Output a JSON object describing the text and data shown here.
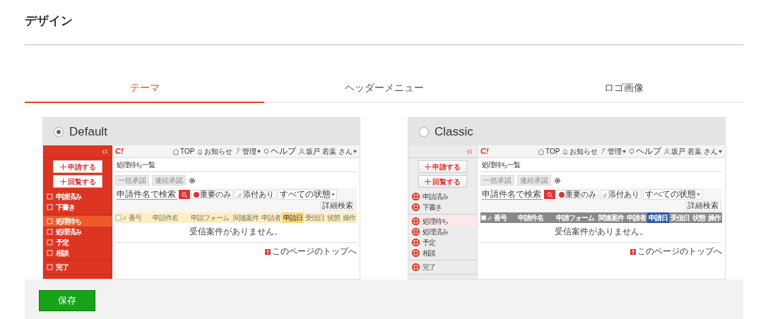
{
  "page_title": "デザイン",
  "tabs": [
    {
      "label": "テーマ",
      "selected": true
    },
    {
      "label": "ヘッダーメニュー",
      "selected": false
    },
    {
      "label": "ロゴ画像",
      "selected": false
    }
  ],
  "themes": [
    {
      "name": "Default",
      "kind": "default",
      "selected": true,
      "preview": {
        "sidebar_buttons": [
          "申請する",
          "回覧する"
        ],
        "sidebar_groups": [
          [
            {
              "label": "申請済み",
              "selected": false
            },
            {
              "label": "下書き",
              "selected": false
            }
          ],
          [
            {
              "label": "処理待ち",
              "selected": true
            },
            {
              "label": "処理済み",
              "selected": false
            },
            {
              "label": "予定",
              "selected": false
            },
            {
              "label": "相談",
              "selected": false
            }
          ],
          [
            {
              "label": "完了",
              "selected": false
            }
          ]
        ],
        "logo": "C!",
        "nav": [
          {
            "label": "TOP",
            "caret": false
          },
          {
            "label": "お知らせ",
            "caret": false
          },
          {
            "label": "管理",
            "caret": true
          },
          {
            "label": "ヘルプ",
            "caret": false
          },
          {
            "label": "坂戸 若葉 さん",
            "caret": true
          }
        ],
        "heading": "処理待ち一覧",
        "actions": [
          "一括承認",
          "連続承認"
        ],
        "search_placeholder": "申請件名で検索",
        "filters": [
          "重要のみ",
          "添付あり"
        ],
        "status_select": "すべての状態",
        "advanced_search": "詳細検索",
        "columns": [
          {
            "label": "番号",
            "selected": false
          },
          {
            "label": "申請件名",
            "selected": false
          },
          {
            "label": "申請フォーム",
            "selected": false
          },
          {
            "label": "関連案件",
            "selected": false
          },
          {
            "label": "申請者",
            "selected": false
          },
          {
            "label": "申請日",
            "selected": true
          },
          {
            "label": "受信日",
            "selected": false
          },
          {
            "label": "状態",
            "selected": false
          },
          {
            "label": "操作",
            "selected": false
          }
        ],
        "empty_message": "受信案件がありません。",
        "page_top_link": "このページのトップへ"
      }
    },
    {
      "name": "Classic",
      "kind": "classic",
      "selected": false,
      "preview": {
        "sidebar_buttons": [
          "申請する",
          "回覧する"
        ],
        "sidebar_groups": [
          [
            {
              "label": "申請済み",
              "selected": false
            },
            {
              "label": "下書き",
              "selected": false
            }
          ],
          [
            {
              "label": "処理待ち",
              "selected": true
            },
            {
              "label": "処理済み",
              "selected": false
            },
            {
              "label": "予定",
              "selected": false
            },
            {
              "label": "相談",
              "selected": false
            }
          ],
          [
            {
              "label": "完了",
              "selected": false
            }
          ]
        ],
        "logo": "C!",
        "nav": [
          {
            "label": "TOP",
            "caret": false
          },
          {
            "label": "お知らせ",
            "caret": false
          },
          {
            "label": "管理",
            "caret": true
          },
          {
            "label": "ヘルプ",
            "caret": false
          },
          {
            "label": "坂戸 若葉 さん",
            "caret": true
          }
        ],
        "heading": "処理待ち一覧",
        "actions": [
          "一括承認",
          "連続承認"
        ],
        "search_placeholder": "申請件名で検索",
        "filters": [
          "重要のみ",
          "添付あり"
        ],
        "status_select": "すべての状態",
        "advanced_search": "詳細検索",
        "columns": [
          {
            "label": "番号",
            "selected": false
          },
          {
            "label": "申請件名",
            "selected": false
          },
          {
            "label": "申請フォーム",
            "selected": false
          },
          {
            "label": "関連案件",
            "selected": false
          },
          {
            "label": "申請者",
            "selected": false
          },
          {
            "label": "申請日",
            "selected": true
          },
          {
            "label": "受信日",
            "selected": false
          },
          {
            "label": "状態",
            "selected": false
          },
          {
            "label": "操作",
            "selected": false
          }
        ],
        "empty_message": "受信案件がありません。",
        "page_top_link": "このページのトップへ"
      }
    }
  ],
  "save_button": "保存"
}
